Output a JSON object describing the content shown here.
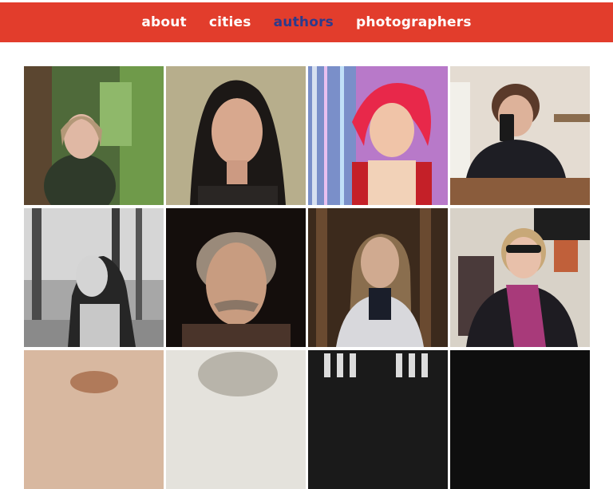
{
  "nav": {
    "about": "about",
    "cities": "cities",
    "authors": "authors",
    "photographers": "photographers",
    "active": "authors",
    "color": "#e23d2c",
    "active_color": "#2c3a8c"
  },
  "portraits": [
    {
      "id": "portrait-1",
      "icon": "person-portrait"
    },
    {
      "id": "portrait-2",
      "icon": "person-portrait"
    },
    {
      "id": "portrait-3",
      "icon": "person-portrait"
    },
    {
      "id": "portrait-4",
      "icon": "person-portrait"
    },
    {
      "id": "portrait-5",
      "icon": "person-portrait"
    },
    {
      "id": "portrait-6",
      "icon": "person-portrait"
    },
    {
      "id": "portrait-7",
      "icon": "person-portrait"
    },
    {
      "id": "portrait-8",
      "icon": "person-portrait"
    },
    {
      "id": "portrait-9",
      "icon": "person-portrait"
    },
    {
      "id": "portrait-10",
      "icon": "person-portrait"
    },
    {
      "id": "portrait-11",
      "icon": "person-portrait"
    },
    {
      "id": "portrait-12",
      "icon": "person-portrait"
    }
  ]
}
